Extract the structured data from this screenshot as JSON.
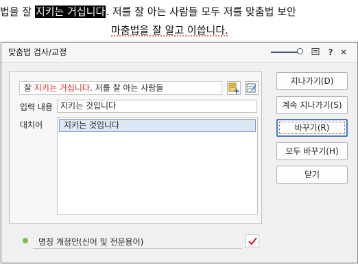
{
  "document": {
    "line1_before": "법을 잘 ",
    "line1_selected": "지키는 거십니다",
    "line1_after": ". 저를 잘 아는 사람들 모두 저를 맞춤법 보안",
    "line2": "마춤법을 잘 알고 이씁니다."
  },
  "dialog": {
    "title": "맞춤법 검사/교정",
    "sentence_pre": "잘 ",
    "sentence_error": "지키는 거십니다",
    "sentence_post": ". 저를 잘 아는 사람들",
    "input_label": "입력 내용",
    "input_value": "지키는 것입니다",
    "suggestions_label": "대치어",
    "suggestions": [
      "지키는 것입니다"
    ],
    "bottom_option": "명칭 개정안(신어 및 전문용어)"
  },
  "buttons": {
    "skip": "지나가기(D)",
    "skip_all": "계속 지나가기(S)",
    "replace": "바꾸기(R)",
    "replace_all": "모두 바꾸기(H)",
    "close": "닫기"
  },
  "colors": {
    "error_text": "#e2201a",
    "default_button_border": "#4a76c6",
    "status_dot": "#7ac143"
  }
}
